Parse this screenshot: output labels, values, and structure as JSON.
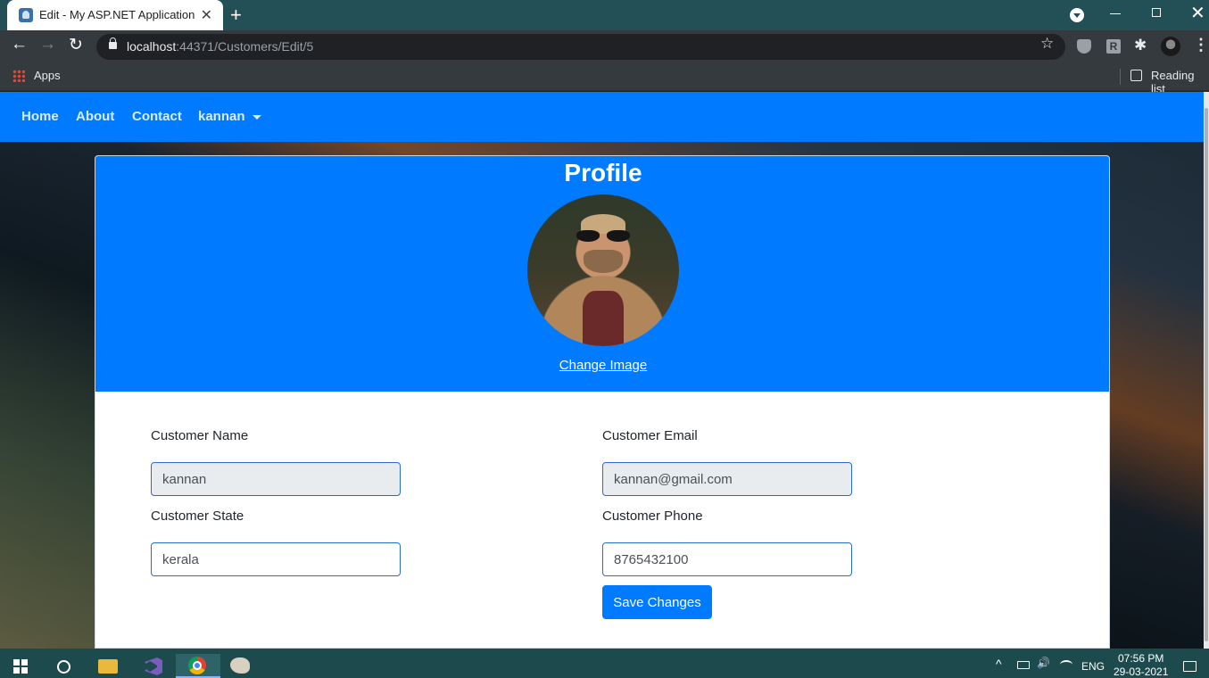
{
  "browser": {
    "tab_title": "Edit - My ASP.NET Application",
    "tab_close": "✕",
    "new_tab": "+",
    "url_host": "localhost",
    "url_path": ":44371/Customers/Edit/5",
    "back": "←",
    "forward": "→",
    "reload": "↻",
    "star": "☆",
    "menu": "⋮",
    "puzzle": "✱",
    "ext_r": "R",
    "win_close": "✕",
    "bookmarks": {
      "apps_label": "Apps",
      "reading_list_label": "Reading list"
    }
  },
  "navbar": {
    "links": [
      "Home",
      "About",
      "Contact"
    ],
    "user": "kannan"
  },
  "profile": {
    "title": "Profile",
    "change_image": "Change Image"
  },
  "form": {
    "name_label": "Customer Name",
    "name_value": "kannan",
    "email_label": "Customer Email",
    "email_value": "kannan@gmail.com",
    "state_label": "Customer State",
    "state_value": "kerala",
    "phone_label": "Customer Phone",
    "phone_value": "8765432100",
    "save_label": "Save Changes"
  },
  "taskbar": {
    "language": "ENG",
    "time": "07:56 PM",
    "date": "29-03-2021",
    "tray_up": "^",
    "volume": "🔊"
  },
  "icons": {
    "tab": "favicon-icon",
    "back": "back-arrow-icon",
    "forward": "forward-arrow-icon",
    "reload": "reload-icon",
    "lock": "lock-icon",
    "star": "star-icon",
    "apps": "apps-grid-icon",
    "reading": "reading-list-icon"
  },
  "colors": {
    "primary": "#007bff",
    "titlebar": "#235056",
    "taskbar": "#1d4a4c"
  }
}
